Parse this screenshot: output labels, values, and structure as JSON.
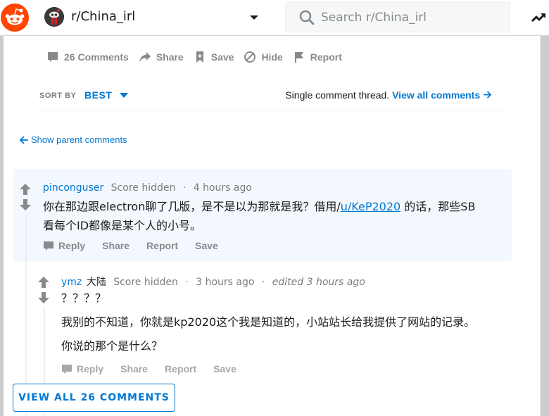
{
  "header": {
    "subreddit": "r/China_irl",
    "search_placeholder": "Search r/China_irl"
  },
  "post_actions": {
    "comments": "26 Comments",
    "share": "Share",
    "save": "Save",
    "hide": "Hide",
    "report": "Report"
  },
  "sort": {
    "label": "SORT BY",
    "value": "BEST"
  },
  "thread_notice": {
    "text": "Single comment thread.",
    "link": "View all comments"
  },
  "show_parent": "Show parent comments",
  "comments": [
    {
      "author": "pinconguser",
      "score": "Score hidden",
      "time": "4 hours ago",
      "body_line1_pre": "你在那边跟electron聊了几版，是不是以为那就是我？借用/",
      "body_link": "u/KeP2020",
      "body_line1_post": " 的话，那些SB",
      "body_line2": "看每个ID都像是某个人的小号。",
      "actions": {
        "reply": "Reply",
        "share": "Share",
        "report": "Report",
        "save": "Save"
      }
    },
    {
      "author": "ymz",
      "flair": "大陆",
      "score": "Score hidden",
      "time": "3 hours ago",
      "edited": "edited 3 hours ago",
      "body_line1": "？？？？",
      "body_line2": "我别的不知道，你就是kp2020这个我是知道的，小站站长给我提供了网站的记录。",
      "body_line3": "你说的那个是什么？",
      "actions": {
        "reply": "Reply",
        "share": "Share",
        "report": "Report",
        "save": "Save"
      }
    }
  ],
  "view_all_button": "VIEW ALL 26 COMMENTS",
  "colors": {
    "brand": "#ff4500",
    "link": "#0079d3",
    "muted": "#878a8c",
    "highlight_bg": "#f3f7fe"
  }
}
